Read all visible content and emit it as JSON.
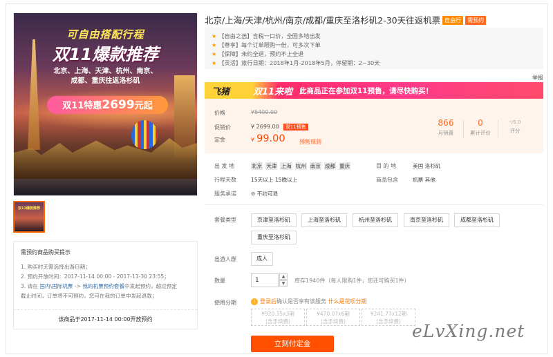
{
  "hero": {
    "line1": "可自由搭配行程",
    "line2": "双11爆款推荐",
    "line3a": "北京、上海、天津、杭州、南京、",
    "line3b": "成都、重庆往返洛杉矶",
    "promo_prefix": "双11特惠",
    "promo_price": "2699",
    "promo_suffix": "元起"
  },
  "thumbnail": {
    "caption": "双11爆款推荐"
  },
  "notice": {
    "heading": "需预约商品购买提示",
    "items": [
      "1. 购买时无需选择出游日期；",
      "2. 预约开放时间：2017-11-14 00:00 - 2017-11-30 23:55；"
    ],
    "item3_prefix": "3. 请在",
    "item3_link1": "国内\\国际机票",
    "item3_arrow": "->",
    "item3_link2": "我的机票预约套餐",
    "item3_suffix": "中发起预约，超过预定",
    "item3_line2": "截止时间，订单将不可预约，您可在我的订单中发起退款；",
    "footer": "该商品于2017-11-14 00:00开放预约"
  },
  "product": {
    "title": "北京/上海/天津/杭州/南京/成都/重庆至洛杉矶2-30天往返机票",
    "tag1": "自由行",
    "tag2": "需预约"
  },
  "features": [
    "【自由之选】含税一口价，全国多地出发",
    "【尊享】每个订单限购一份，可多次下单",
    "【保障】未约全退，预约不上全退",
    "【灵活】旅行日期：2018年1月-2018年5月，停留期：2~30天"
  ],
  "report": "举报",
  "banner": {
    "logo": "飞猪",
    "sale": "双11来啦",
    "text": "此商品正在参加双11预售，请尽快购买！",
    "colors": {
      "yellow": "#ffd23a",
      "pink": "#ff2d6a"
    }
  },
  "price": {
    "label_price": "价格",
    "label_promo": "促销价",
    "label_deposit": "定金",
    "original": "¥5400.00",
    "promo": "¥ 2699.00",
    "presale_tag": "双11预售",
    "deposit_symbol": "¥",
    "deposit": "99.00",
    "rule_link": "预售规则"
  },
  "stats": {
    "sales_num": "866",
    "sales_label": "月销量",
    "reviews_num": "0",
    "reviews_label": "累计评价",
    "score_num": "-",
    "score_max": "/5.0",
    "score_label": "评分"
  },
  "info": {
    "origin_label": "出 发 地",
    "origins": [
      "北京",
      "天津",
      "上海",
      "杭州",
      "南京",
      "成都",
      "重庆"
    ],
    "dest_label": "目 的 地",
    "dest_value": "美国  洛杉矶",
    "days_label": "行程天数",
    "days_value": "15天以上   15晚以上",
    "include_label": "商品包含",
    "include_value": "机票  其他",
    "promise_label": "服务承诺",
    "promise_value": "不约可退"
  },
  "package": {
    "label": "套餐类型",
    "options": [
      "京津至洛杉矶",
      "上海至洛杉矶",
      "杭州至洛杉矶",
      "南京至洛杉矶",
      "成都至洛杉矶",
      "重庆至洛杉矶"
    ]
  },
  "traveler": {
    "label": "出游人群",
    "option": "成人"
  },
  "quantity": {
    "label": "数量",
    "value": "1",
    "up": "▲",
    "down": "▼",
    "stock": "库存1940件（每人限购1件，您还可购买1件）"
  },
  "installment": {
    "label": "使用分期",
    "note_icon": "!",
    "note_link1": "登录后",
    "note_text": "确认是否享有该服务",
    "note_link2": "什么是花呗分期",
    "options": [
      {
        "price": "¥920.35x3期",
        "fee": "(含手续费)"
      },
      {
        "price": "¥470.07x6期",
        "fee": "(含手续费)"
      },
      {
        "price": "¥241.77x12期",
        "fee": "(含手续费)"
      }
    ]
  },
  "buy_button": "立刻付定金",
  "watermark": "eLvXing.net"
}
